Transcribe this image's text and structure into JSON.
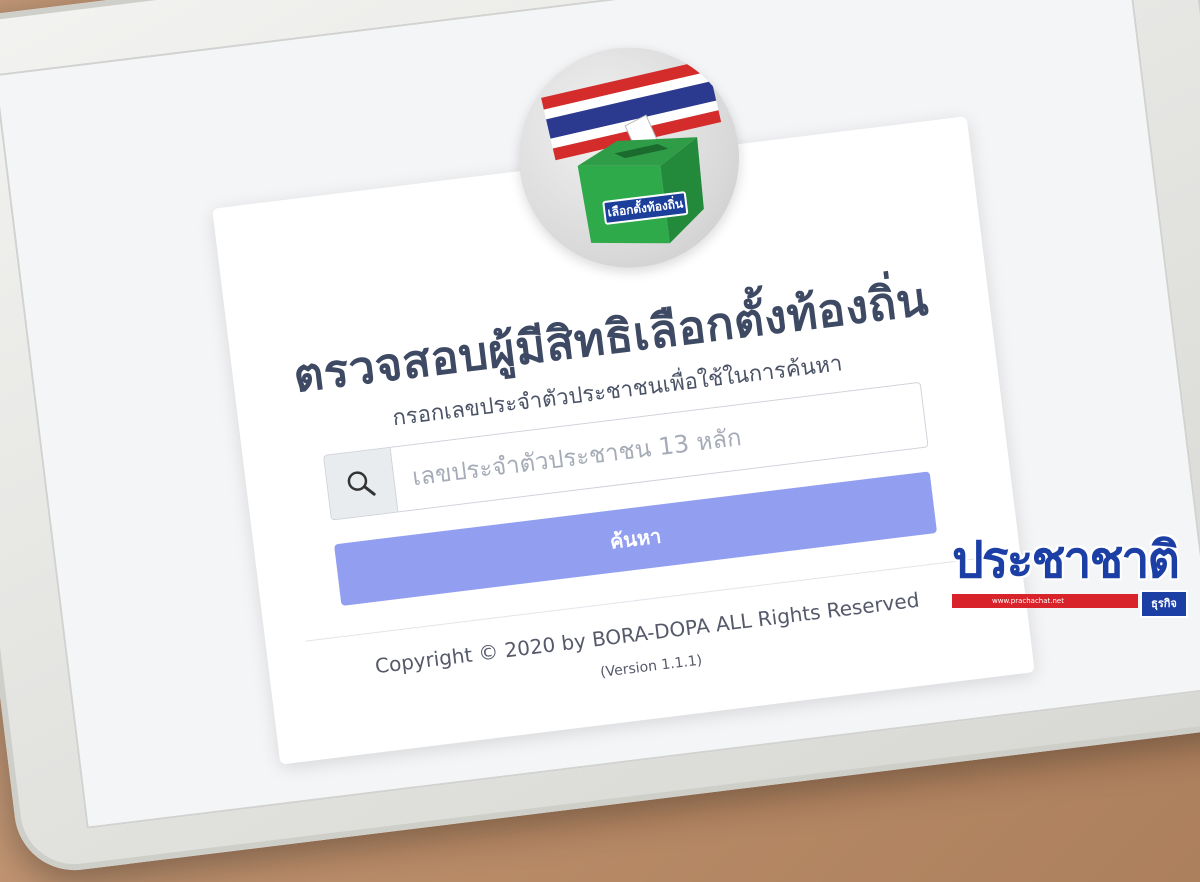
{
  "page": {
    "title": "ตรวจสอบผู้มีสิทธิเลือกตั้งท้องถิ่น",
    "subtitle": "กรอกเลขประจำตัวประชาชนเพื่อใช้ในการค้นหา",
    "logo_label": "เลือกตั้งท้องถิ่น"
  },
  "search": {
    "placeholder": "เลขประจำตัวประชาชน 13 หลัก",
    "value": "",
    "button_label": "ค้นหา",
    "icon": "search-icon"
  },
  "footer": {
    "copyright": "Copyright © 2020 by BORA-DOPA ALL Rights Reserved",
    "version": "(Version 1.1.1)"
  },
  "watermark": {
    "brand": "ประชาชาติ",
    "url": "www.prachachat.net",
    "tag": "ธุรกิจ"
  },
  "colors": {
    "button": "#929ff0",
    "title_text": "#3e4a63",
    "ballot_box": "#2eaa4a",
    "brand_blue": "#1c3fa6",
    "brand_red": "#d8232a"
  }
}
